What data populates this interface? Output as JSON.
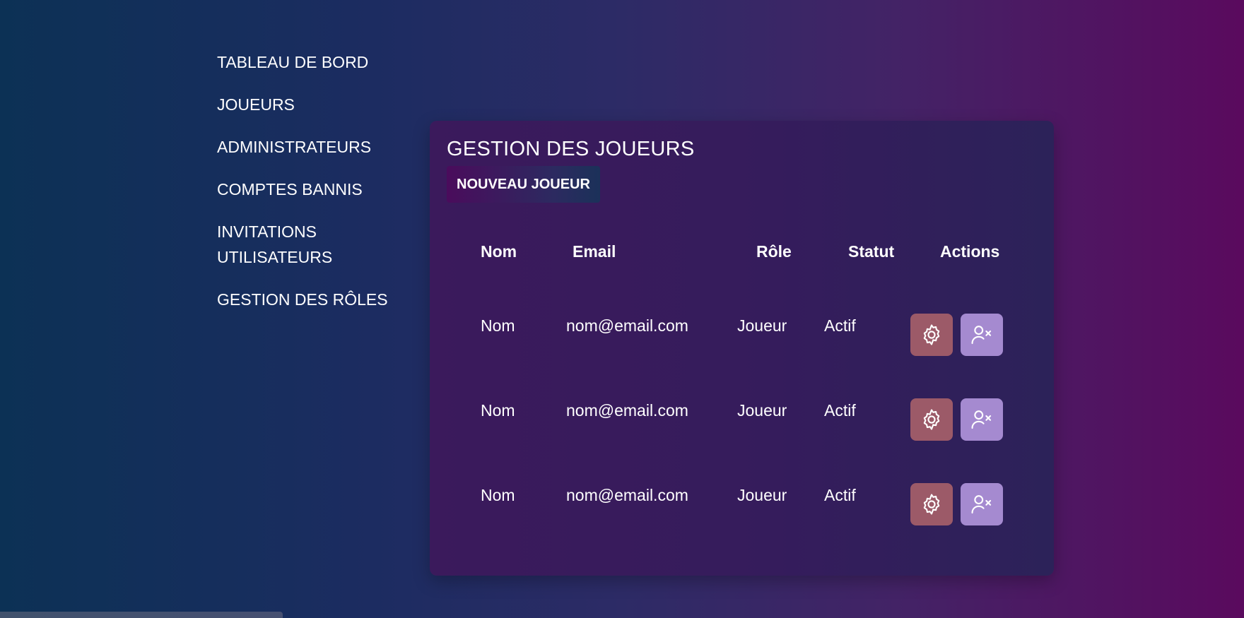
{
  "sidebar": {
    "items": [
      {
        "label": "TABLEAU DE BORD"
      },
      {
        "label": "JOUEURS"
      },
      {
        "label": "ADMINISTRATEURS"
      },
      {
        "label": "COMPTES BANNIS"
      },
      {
        "label": "INVITATIONS UTILISATEURS"
      },
      {
        "label": "GESTION DES RÔLES"
      }
    ]
  },
  "main": {
    "title": "GESTION DES JOUEURS",
    "new_button": "NOUVEAU JOUEUR",
    "table": {
      "headers": [
        "Nom",
        "Email",
        "Rôle",
        "Statut",
        "Actions"
      ],
      "rows": [
        {
          "nom": "Nom",
          "email": "nom@email.com",
          "role": "Joueur",
          "statut": "Actif",
          "actions": [
            "gear-icon",
            "user-remove-icon"
          ]
        },
        {
          "nom": "Nom",
          "email": "nom@email.com",
          "role": "Joueur",
          "statut": "Actif",
          "actions": [
            "gear-icon",
            "user-remove-icon"
          ]
        },
        {
          "nom": "Nom",
          "email": "nom@email.com",
          "role": "Joueur",
          "statut": "Actif",
          "actions": [
            "gear-icon",
            "user-remove-icon"
          ]
        }
      ]
    }
  },
  "colors": {
    "settings_button": "#9c5a68",
    "ban_button": "#a58ad0",
    "card_background": "#3b1a5c"
  }
}
